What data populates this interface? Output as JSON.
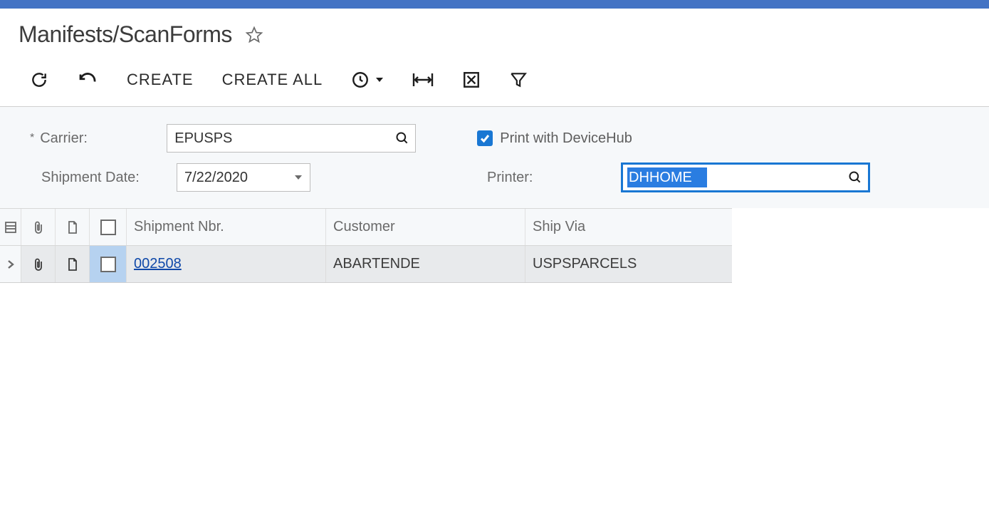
{
  "page": {
    "title": "Manifests/ScanForms"
  },
  "toolbar": {
    "create_label": "CREATE",
    "create_all_label": "CREATE ALL"
  },
  "form": {
    "carrier_label": "Carrier:",
    "carrier_value": "EPUSPS",
    "shipment_date_label": "Shipment Date:",
    "shipment_date_value": "7/22/2020",
    "print_devicehub_label": "Print with DeviceHub",
    "print_devicehub_checked": true,
    "printer_label": "Printer:",
    "printer_value": "DHHOME"
  },
  "grid": {
    "headers": {
      "shipment_nbr": "Shipment Nbr.",
      "customer": "Customer",
      "ship_via": "Ship Via"
    },
    "rows": [
      {
        "shipment_nbr": "002508",
        "customer": "ABARTENDE",
        "ship_via": "USPSPARCELS"
      }
    ]
  }
}
